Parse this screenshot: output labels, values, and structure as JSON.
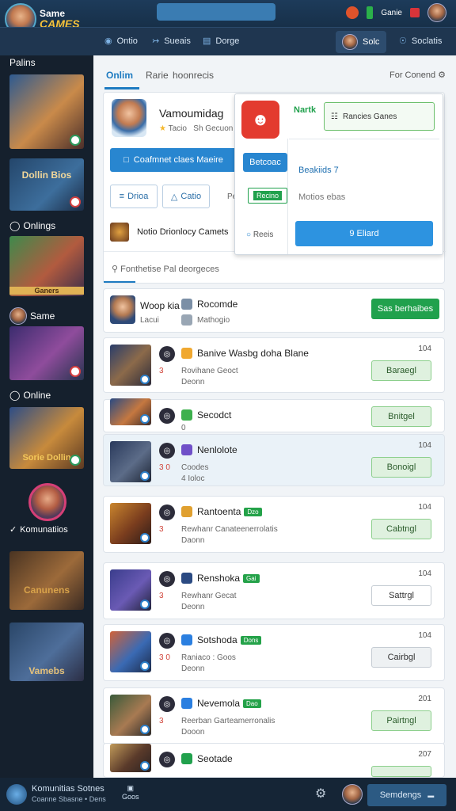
{
  "brand": {
    "line1": "Same",
    "line2": "CAMES"
  },
  "topbar": {
    "status_label": "Ganie"
  },
  "nav": {
    "items": [
      "Ontio",
      "Sueais",
      "Dorge"
    ],
    "profile_label": "Solc",
    "settings_label": "Soclatis"
  },
  "sidebar": {
    "sections": [
      "Palins",
      "Onlings",
      "Same",
      "Online",
      "Komunatiios"
    ],
    "tiles": [
      "",
      "Dollin Bios",
      "Ganers",
      "",
      "Sorie Dollin",
      "Canunens",
      "Vamebs"
    ]
  },
  "tabs": {
    "active": "Onlim",
    "t2": "Rarie",
    "t3": "hoonrecis",
    "right": "For Conend"
  },
  "profile": {
    "name": "Vamoumidag",
    "meta1": "Tacio",
    "meta2": "Sh Gecuon",
    "primary_button": "Coafmnet claes Maeire",
    "btn_a": "Drioa",
    "btn_b": "Catio",
    "btn_c": "Pe",
    "featured": "Notio Drionlocy Camets",
    "search_placeholder": "Fonthetise Pal deorgeces"
  },
  "popup": {
    "badge": "Nartk",
    "field": "Rancies Ganes",
    "btn_blue": "Betcoac",
    "btn_green": "Recino",
    "radio": "Reeis",
    "line1": "Beakiids 7",
    "line2": "Motios ebas",
    "action": "9 Eliard"
  },
  "friend_row": {
    "name": "Woop kia",
    "sub": "Lacui",
    "game": "Rocomde",
    "game_sub": "Mathogio",
    "button": "Sas berhaibes"
  },
  "games": [
    {
      "title": "Banive Wasbg doha Blane",
      "a": "3",
      "sub": "Rovihane Geoct",
      "sub2": "Deonn",
      "num": "104",
      "button": "Baraegl",
      "btnstyle": "green",
      "tag": ""
    },
    {
      "title": "Secodct",
      "a": "",
      "sub": "",
      "sub2": "0",
      "num": "",
      "button": "Bnitgel",
      "btnstyle": "green",
      "tag": ""
    },
    {
      "title": "Nenlolote",
      "a": "3 0",
      "sub": "Coodes",
      "sub2": "4 Ioloc",
      "num": "104",
      "button": "Bonoigl",
      "btnstyle": "green",
      "tag": ""
    },
    {
      "title": "Rantoenta",
      "a": "3",
      "sub": "Rewhanr Canateenerrolatis",
      "sub2": "Daonn",
      "num": "104",
      "button": "Cabtngl",
      "btnstyle": "green",
      "tag": "Dzo"
    },
    {
      "title": "Renshoka",
      "a": "3",
      "sub": "Rewhanr Gecat",
      "sub2": "Deonn",
      "num": "104",
      "button": "Sattrgl",
      "btnstyle": "plain",
      "tag": "Gai"
    },
    {
      "title": "Sotshoda",
      "a": "3 0",
      "sub": "Raniaco : Goos",
      "sub2": "Deonn",
      "num": "104",
      "button": "Cairbgl",
      "btnstyle": "greyish",
      "tag": "Dons"
    },
    {
      "title": "Nevemola",
      "a": "3",
      "sub": "Reerban Garteamerronalis",
      "sub2": "Dooon",
      "num": "201",
      "button": "Pairtngl",
      "btnstyle": "green",
      "tag": "Dao"
    },
    {
      "title": "Seotade",
      "a": "",
      "sub": "",
      "sub2": "",
      "num": "207",
      "button": "",
      "btnstyle": "green",
      "tag": ""
    }
  ],
  "bottom": {
    "title": "Komunitias Sotnes",
    "sub": "Coanne Sbasne • Dens",
    "icon_label": "Goos",
    "button": "Semdengs"
  },
  "colors": {
    "accent": "#2886d0",
    "green": "#21a14d",
    "sidebar": "#15202d",
    "topbar": "#1d3b5a"
  }
}
